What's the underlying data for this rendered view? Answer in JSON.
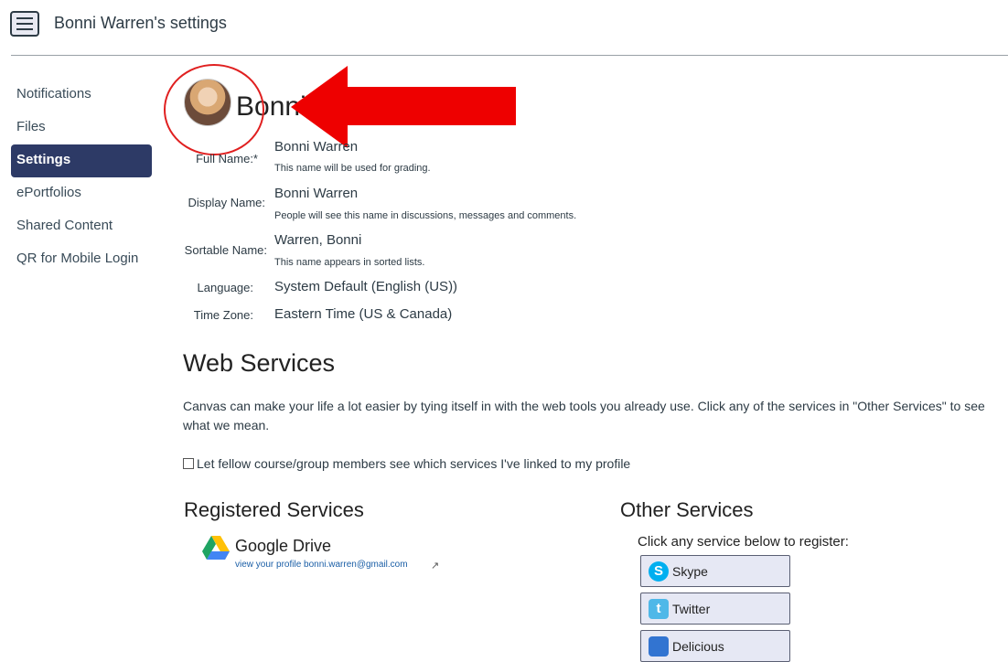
{
  "header": {
    "title": "Bonni Warren's settings"
  },
  "nav": {
    "items": [
      {
        "label": "Notifications"
      },
      {
        "label": "Files"
      },
      {
        "label": "Settings"
      },
      {
        "label": "ePortfolios"
      },
      {
        "label": "Shared Content"
      },
      {
        "label": "QR for Mobile Login"
      }
    ],
    "active": "Settings"
  },
  "profile": {
    "heading": "Bonni",
    "fields": [
      {
        "label": "Full Name:*",
        "value": "Bonni Warren",
        "hint": "This name will be used for grading."
      },
      {
        "label": "Display Name:",
        "value": "Bonni Warren",
        "hint": "People will see this name in discussions, messages and comments."
      },
      {
        "label": "Sortable Name:",
        "value": "Warren, Bonni",
        "hint": "This name appears in sorted lists."
      },
      {
        "label": "Language:",
        "value": "System Default (English (US))"
      },
      {
        "label": "Time Zone:",
        "value": "Eastern Time (US & Canada)"
      }
    ]
  },
  "web_services": {
    "heading": "Web Services",
    "description": "Canvas can make your life a lot easier by tying itself in with the web tools you already use. Click any of the services in \"Other Services\" to see what we mean.",
    "checkbox_label": "Let fellow course/group members see which services I've linked to my profile",
    "registered": {
      "heading": "Registered Services",
      "items": [
        {
          "name": "Google Drive",
          "link": "view your profile bonni.warren@gmail.com"
        }
      ]
    },
    "other": {
      "heading": "Other Services",
      "hint": "Click any service below to register:",
      "buttons": [
        {
          "label": "Skype"
        },
        {
          "label": "Twitter"
        },
        {
          "label": "Delicious"
        }
      ]
    }
  },
  "colors": {
    "nav_active_bg": "#2d3a66",
    "annotation": "#e02020",
    "link": "#1a5ea6"
  }
}
